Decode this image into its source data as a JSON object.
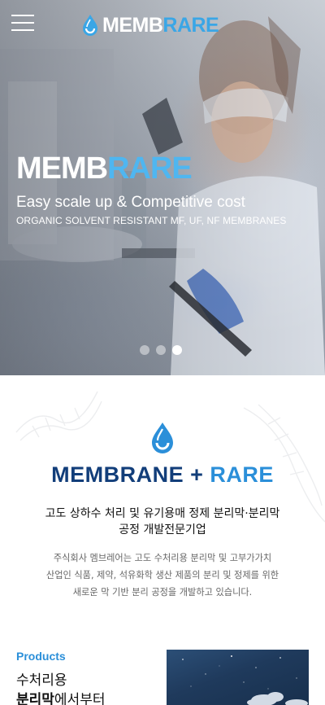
{
  "header": {
    "menu_icon": "hamburger-menu-icon",
    "logo": {
      "part1": "MEMB",
      "part2": "RARE"
    }
  },
  "hero": {
    "title_part1": "MEMB",
    "title_part2": "RARE",
    "subtitle": "Easy scale up & Competitive cost",
    "tagline": "ORGANIC SOLVENT RESISTANT MF, UF, NF MEMBRANES",
    "slides": {
      "count": 3,
      "active": 3
    }
  },
  "intro": {
    "brand_part1": "MEMBRANE + ",
    "brand_part2": "RARE",
    "headline_line1": "고도 상하수 처리 및 유기용매 정제 분리막·분리막",
    "headline_line2": "공정 개발전문기업",
    "body_line1": "주식회사 멤브레어는 고도 수처리용 분리막 및 고부가가치",
    "body_line2": "산업인 식품, 제약, 석유화학 생산 제품의 분리 및 정제를 위한",
    "body_line3": "새로운 막 기반 분리 공정을 개발하고 있습니다."
  },
  "products": {
    "label": "Products",
    "title_line1": "수처리용",
    "title_line2_bold": "분리막",
    "title_line2_rest": "에서부터"
  },
  "colors": {
    "brand_blue": "#2b8fd9",
    "brand_navy": "#123e7a",
    "logo_blue": "#3aa6e6"
  }
}
